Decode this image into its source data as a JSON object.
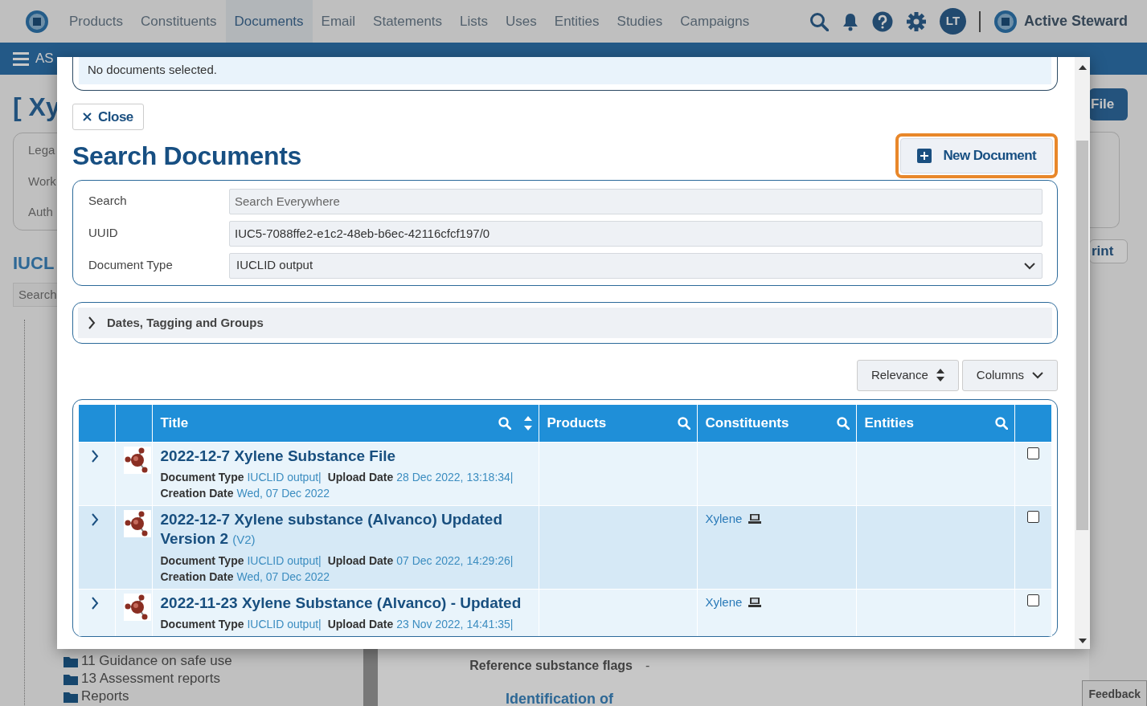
{
  "nav": {
    "items": [
      {
        "label": "Products",
        "selected": false
      },
      {
        "label": "Constituents",
        "selected": false
      },
      {
        "label": "Documents",
        "selected": true
      },
      {
        "label": "Email",
        "selected": false
      },
      {
        "label": "Statements",
        "selected": false
      },
      {
        "label": "Lists",
        "selected": false
      },
      {
        "label": "Uses",
        "selected": false
      },
      {
        "label": "Entities",
        "selected": false
      },
      {
        "label": "Studies",
        "selected": false
      },
      {
        "label": "Campaigns",
        "selected": false
      }
    ],
    "user_initials": "LT",
    "brand": "Active Steward"
  },
  "breadcrumb": {
    "label": "AS"
  },
  "background": {
    "title": "[ Xy",
    "fields": [
      "Lega",
      "Work",
      "Auth"
    ],
    "section_title": "IUCL",
    "search_placeholder": "Search",
    "tree_items": [
      "11 Guidance on safe use",
      "13 Assessment reports",
      "Reports"
    ],
    "file_button": "File",
    "print_button": "rint",
    "property": {
      "label": "Reference substance flags",
      "value": "-"
    },
    "section2": "Identification of",
    "feedback": "Feedback"
  },
  "modal": {
    "selection_notice": "No documents selected.",
    "close_label": "Close",
    "title": "Search Documents",
    "new_button": {
      "label": "New Document",
      "highlighted": true
    },
    "form": [
      {
        "kind": "text",
        "label": "Search",
        "placeholder": "Search Everywhere"
      },
      {
        "kind": "text",
        "label": "UUID",
        "value": "IUC5-7088ffe2-e1c2-48eb-b6ec-42116cfcf197/0"
      },
      {
        "kind": "select",
        "label": "Document Type",
        "value": "IUCLID output"
      }
    ],
    "filters": {
      "label": "Dates, Tagging and Groups",
      "expanded": false
    },
    "sort_button": "Relevance",
    "columns_button": "Columns",
    "table": {
      "columns": [
        {
          "label": "Title",
          "sortable": true
        },
        {
          "label": "Products",
          "sortable": false
        },
        {
          "label": "Constituents",
          "sortable": false
        },
        {
          "label": "Entities",
          "sortable": false
        }
      ],
      "rows": [
        {
          "title": "2022-12-7 Xylene Substance File",
          "meta": [
            {
              "label": "Document Type",
              "value": "IUCLID output|"
            },
            {
              "label": "Upload Date",
              "value": "28 Dec 2022, 13:18:34|"
            },
            {
              "label": "Creation Date",
              "value": "Wed, 07 Dec 2022"
            }
          ],
          "constituents": [],
          "checked": false,
          "expanded": false
        },
        {
          "title": "2022-12-7 Xylene substance (Alvanco) Updated Version 2",
          "version": "(V2)",
          "meta": [
            {
              "label": "Document Type",
              "value": "IUCLID output|"
            },
            {
              "label": "Upload Date",
              "value": "07 Dec 2022, 14:29:26|"
            },
            {
              "label": "Creation Date",
              "value": "Wed, 07 Dec 2022"
            }
          ],
          "constituents": [
            "Xylene"
          ],
          "checked": false,
          "expanded": false
        },
        {
          "title": "2022-11-23 Xylene Substance (Alvanco) - Updated",
          "meta": [
            {
              "label": "Document Type",
              "value": "IUCLID output|"
            },
            {
              "label": "Upload Date",
              "value": "23 Nov 2022, 14:41:35|"
            }
          ],
          "constituents": [
            "Xylene"
          ],
          "checked": false,
          "expanded": false
        }
      ]
    }
  }
}
